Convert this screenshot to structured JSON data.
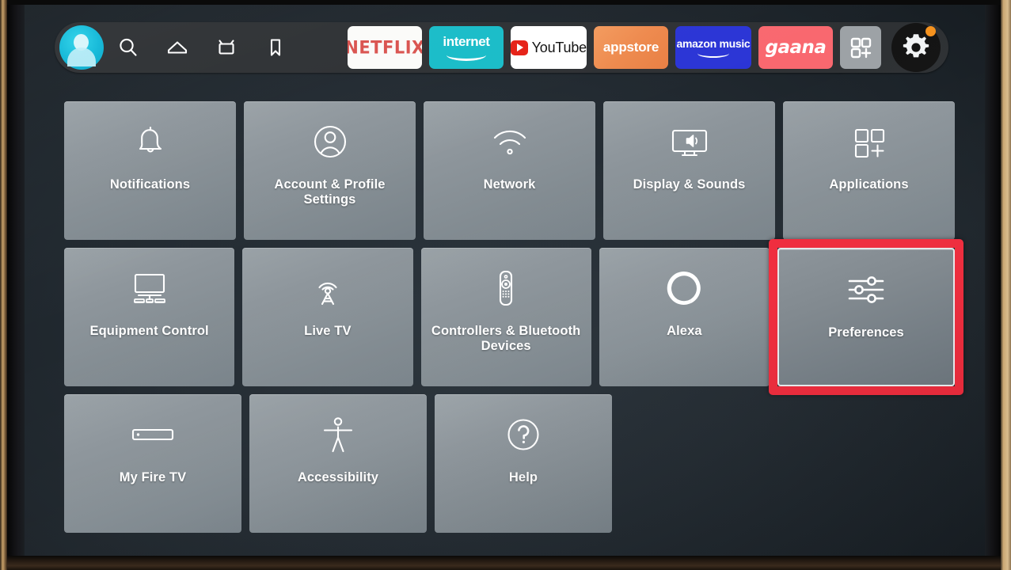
{
  "device": {
    "platform": "Fire TV",
    "screen_title": "Settings"
  },
  "topbar": {
    "avatar": {
      "icon": "profile-avatar-icon",
      "color": "#12b8d8"
    },
    "nav_items": [
      {
        "name": "search",
        "icon": "search-icon"
      },
      {
        "name": "home",
        "icon": "home-icon"
      },
      {
        "name": "live-tv",
        "icon": "tv-icon"
      },
      {
        "name": "watchlist",
        "icon": "bookmark-icon"
      }
    ],
    "apps": [
      {
        "label": "NETFLIX",
        "name": "netflix",
        "bg": "#fbfbf9",
        "fg": "#d9534f"
      },
      {
        "label": "internet",
        "name": "internet",
        "bg": "#19bcc8",
        "fg": "#ffffff"
      },
      {
        "label": "YouTube",
        "name": "youtube",
        "bg": "#ffffff",
        "fg": "#111111"
      },
      {
        "label": "appstore",
        "name": "appstore",
        "bg": "#ee8a4e",
        "fg": "#ffffff"
      },
      {
        "label": "amazon music",
        "name": "amazon-music",
        "bg": "#2b35d6",
        "fg": "#ffffff"
      },
      {
        "label": "gaana",
        "name": "gaana",
        "bg": "#f9686f",
        "fg": "#ffffff"
      }
    ],
    "app_grid": {
      "name": "app-grid-button",
      "icon": "grid-plus-icon",
      "bg": "#9da2a6"
    },
    "settings": {
      "name": "settings-button",
      "icon": "gear-icon",
      "badge": true,
      "badge_color": "#f5921e"
    }
  },
  "settings_grid": {
    "selected": "Preferences",
    "selection_color": "#ef2b3c",
    "tiles": [
      {
        "label": "Notifications",
        "icon": "bell-icon",
        "selected": false
      },
      {
        "label": "Account & Profile Settings",
        "icon": "person-circle-icon",
        "selected": false
      },
      {
        "label": "Network",
        "icon": "wifi-icon",
        "selected": false
      },
      {
        "label": "Display & Sounds",
        "icon": "display-sound-icon",
        "selected": false
      },
      {
        "label": "Applications",
        "icon": "grid-plus-icon",
        "selected": false
      },
      {
        "label": "Equipment Control",
        "icon": "monitor-devices-icon",
        "selected": false
      },
      {
        "label": "Live TV",
        "icon": "antenna-icon",
        "selected": false
      },
      {
        "label": "Controllers & Bluetooth Devices",
        "icon": "remote-control-icon",
        "selected": false
      },
      {
        "label": "Alexa",
        "icon": "alexa-ring-icon",
        "selected": false
      },
      {
        "label": "Preferences",
        "icon": "sliders-icon",
        "selected": true
      },
      {
        "label": "My Fire TV",
        "icon": "fire-stick-icon",
        "selected": false
      },
      {
        "label": "Accessibility",
        "icon": "accessibility-icon",
        "selected": false
      },
      {
        "label": "Help",
        "icon": "question-circle-icon",
        "selected": false
      }
    ]
  }
}
